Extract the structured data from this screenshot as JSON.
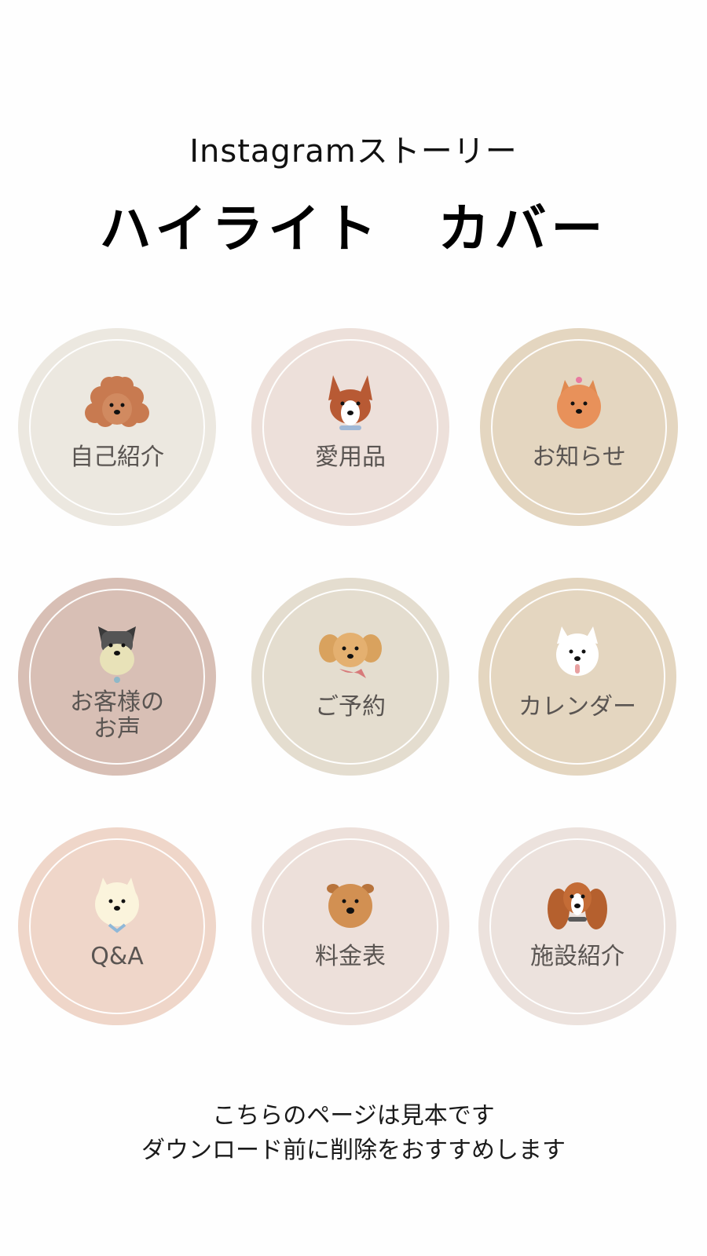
{
  "header": {
    "subtitle": "Instagramストーリー",
    "title": "ハイライト　カバー"
  },
  "covers": [
    {
      "label": "自己紹介",
      "bg": "#ece8e0",
      "icon": "poodle-icon"
    },
    {
      "label": "愛用品",
      "bg": "#ede0da",
      "icon": "corgi-icon"
    },
    {
      "label": "お知らせ",
      "bg": "#e4d6c0",
      "icon": "pomeranian-icon"
    },
    {
      "label_line1": "お客様の",
      "label_line2": "お声",
      "bg": "#d8bfb5",
      "icon": "schnauzer-icon"
    },
    {
      "label": "ご予約",
      "bg": "#e4ddcf",
      "icon": "golden-dog-icon"
    },
    {
      "label": "カレンダー",
      "bg": "#e4d6c0",
      "icon": "spitz-icon"
    },
    {
      "label": "Q&A",
      "bg": "#efd6c9",
      "icon": "samoyed-icon"
    },
    {
      "label": "料金表",
      "bg": "#ede0da",
      "icon": "chow-chow-icon"
    },
    {
      "label": "施設紹介",
      "bg": "#ece2dd",
      "icon": "basset-icon"
    }
  ],
  "footer": {
    "line1": "こちらのページは見本です",
    "line2": "ダウンロード前に削除をおすすめします"
  }
}
